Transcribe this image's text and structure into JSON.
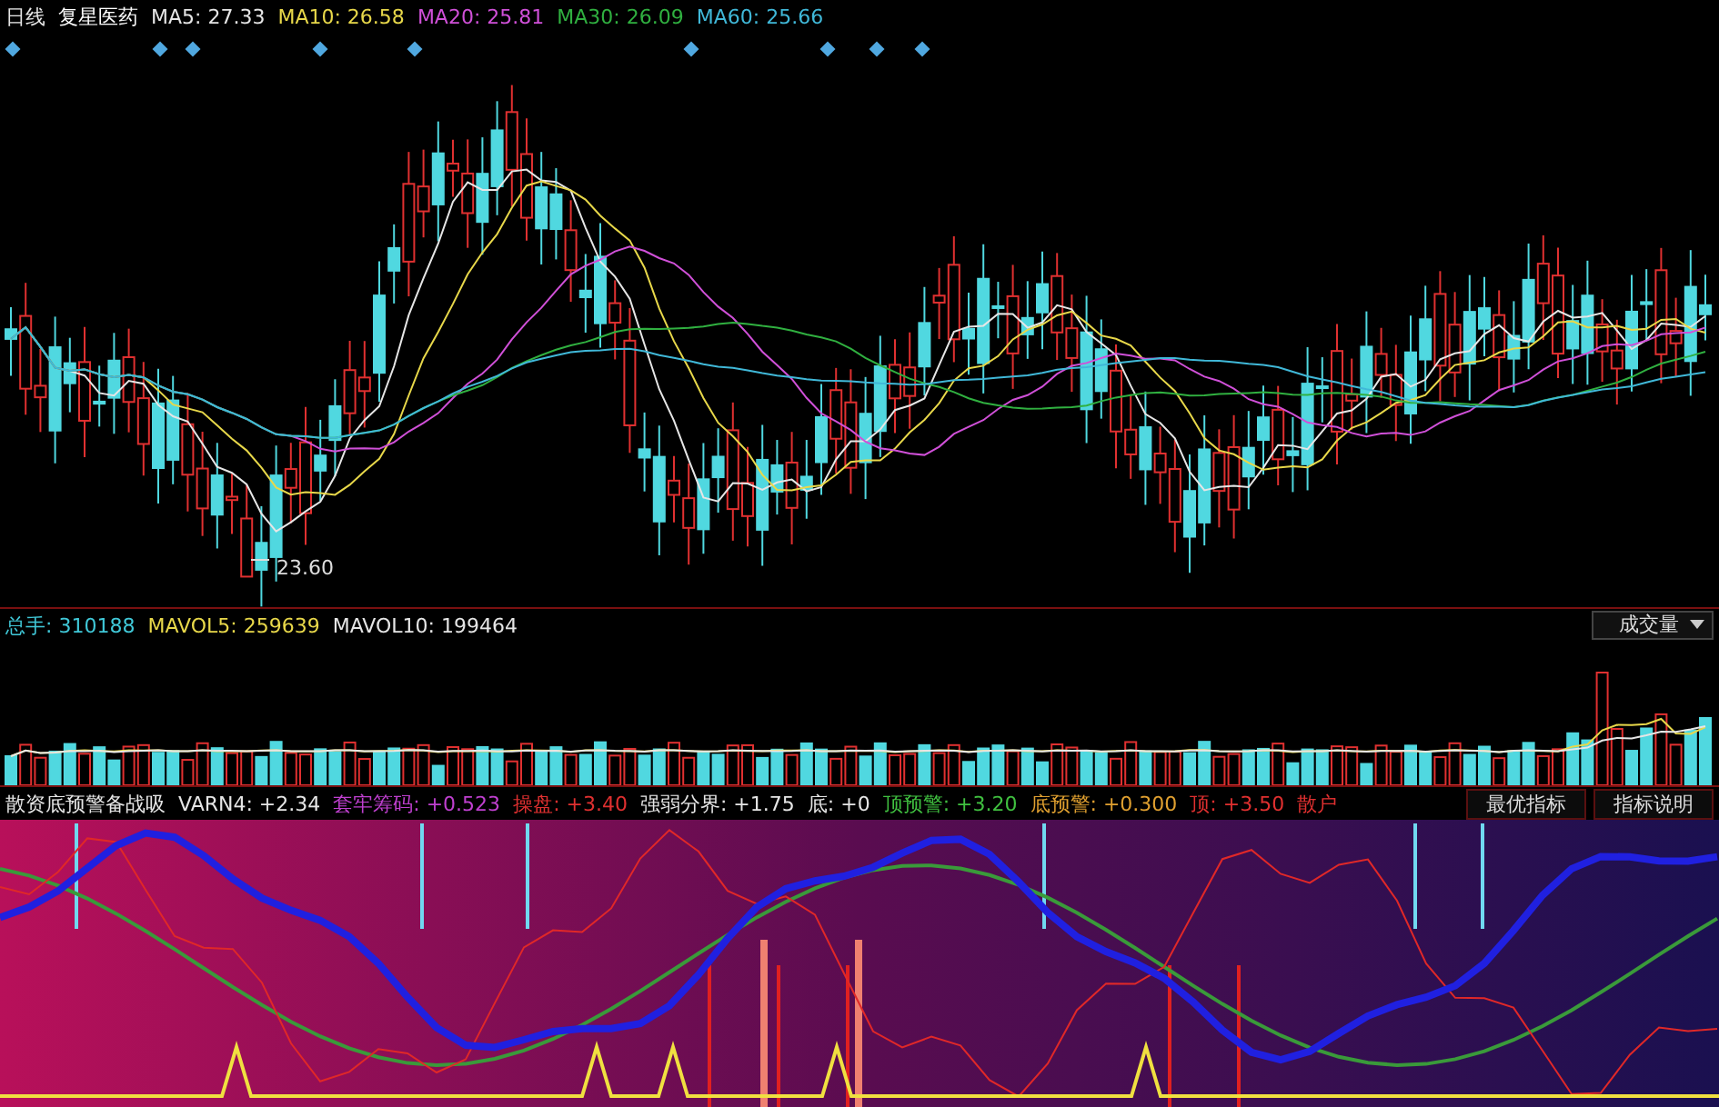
{
  "price_pane": {
    "period": "日线",
    "stock": "复星医药",
    "ma_readings": [
      {
        "label": "MA5: 27.33",
        "color": "#e6e6e6"
      },
      {
        "label": "MA10: 26.58",
        "color": "#e8d84a"
      },
      {
        "label": "MA20: 25.81",
        "color": "#d050d8"
      },
      {
        "label": "MA30: 26.09",
        "color": "#30b040"
      },
      {
        "label": "MA60: 25.66",
        "color": "#40b8d8"
      }
    ],
    "low_marker": "23.60"
  },
  "volume_pane": {
    "readings": [
      {
        "label": "总手: 310188",
        "color": "#40c8d8"
      },
      {
        "label": "MAVOL5: 259639",
        "color": "#e8d84a"
      },
      {
        "label": "MAVOL10: 199464",
        "color": "#e6e6e6"
      }
    ],
    "indicator_select": "成交量"
  },
  "indicator_pane": {
    "readings": [
      {
        "label": "散资底预警备战吸",
        "color": "#e6e6e6"
      },
      {
        "label": "VARN4: +2.34",
        "color": "#e6e6e6"
      },
      {
        "label": "套牢筹码: +0.523",
        "color": "#c040d0"
      },
      {
        "label": "操盘: +3.40",
        "color": "#e03030"
      },
      {
        "label": "强弱分界: +1.75",
        "color": "#e6e6e6"
      },
      {
        "label": "底: +0",
        "color": "#e6e6e6"
      },
      {
        "label": "顶预警: +3.20",
        "color": "#40c040"
      },
      {
        "label": "底预警: +0.300",
        "color": "#e0a030"
      },
      {
        "label": "顶: +3.50",
        "color": "#e03030"
      },
      {
        "label": "散户",
        "color": "#e03030"
      }
    ],
    "buttons": [
      "最优指标",
      "指标说明"
    ]
  }
}
